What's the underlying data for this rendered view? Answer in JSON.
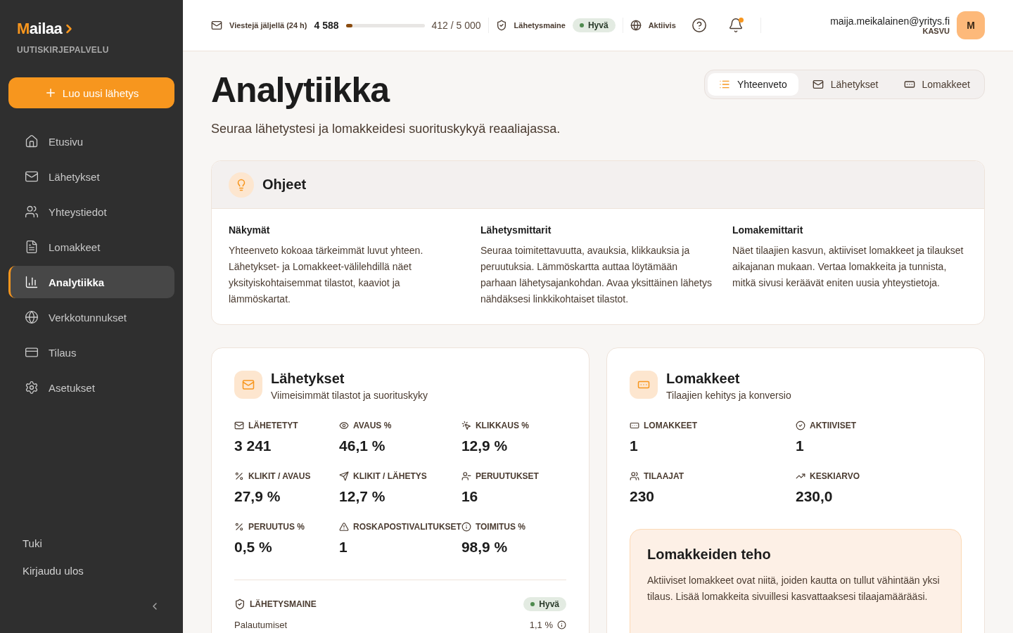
{
  "sidebar": {
    "logo": {
      "accent": "M",
      "rest": "ailaa"
    },
    "tagline": "UUTISKIRJEPALVELU",
    "new_button": "Luo uusi lähetys",
    "nav": [
      {
        "label": "Etusivu",
        "selected": false
      },
      {
        "label": "Lähetykset",
        "selected": false
      },
      {
        "label": "Yhteystiedot",
        "selected": false
      },
      {
        "label": "Lomakkeet",
        "selected": false
      },
      {
        "label": "Analytiikka",
        "selected": true
      },
      {
        "label": "Verkkotunnukset",
        "selected": false
      },
      {
        "label": "Tilaus",
        "selected": false
      },
      {
        "label": "Asetukset",
        "selected": false
      }
    ],
    "footer_links": [
      "Tuki",
      "Kirjaudu ulos"
    ]
  },
  "topbar": {
    "quota": {
      "label": "Viestejä jäljellä (24 h)",
      "remaining": "4 588",
      "level": 0.082,
      "usage": "412 / 5 000"
    },
    "reputation": {
      "label": "Lähetysmaine",
      "badge": "Hyvä",
      "color": "#4e8a4e"
    },
    "status": "Aktiivis",
    "notification_dot": true,
    "user": {
      "email": "maija.meikalainen@yritys.fi",
      "plan": "KASVU",
      "initial": "M"
    }
  },
  "page": {
    "title": "Analytiikka",
    "subtitle": "Seuraa lähetystesi ja lomakkeidesi suorituskykyä reaaliajassa.",
    "tabs": [
      {
        "label": "Yhteenveto",
        "selected": true
      },
      {
        "label": "Lähetykset",
        "selected": false
      },
      {
        "label": "Lomakkeet",
        "selected": false
      }
    ]
  },
  "guide": {
    "title": "Ohjeet",
    "columns": [
      {
        "title": "Näkymät",
        "text": "Yhteenveto kokoaa tärkeimmät luvut yhteen. Lähetykset- ja Lomakkeet-välilehdillä näet yksityiskohtaisemmat tilastot, kaaviot ja lämmöskartat."
      },
      {
        "title": "Lähetysmittarit",
        "text": "Seuraa toimitettavuutta, avauksia, klikkauksia ja peruutuksia. Lämmöskartta auttaa löytämään parhaan lähetysajankohdan. Avaa yksittäinen lähetys nähdäksesi linkkikohtaiset tilastot."
      },
      {
        "title": "Lomakemittarit",
        "text": "Näet tilaajien kasvun, aktiiviset lomakkeet ja tilaukset aikajanan mukaan. Vertaa lomakkeita ja tunnista, mitkä sivusi keräävät eniten uusia yhteystietoja."
      }
    ]
  },
  "sends": {
    "title": "Lähetykset",
    "subtitle": "Viimeisimmät tilastot ja suorituskyky",
    "metrics": [
      {
        "label": "LÄHETETYT",
        "value": "3 241"
      },
      {
        "label": "AVAUS %",
        "value": "46,1 %"
      },
      {
        "label": "KLIKKAUS %",
        "value": "12,9 %"
      },
      {
        "label": "KLIKIT / AVAUS",
        "value": "27,9 %"
      },
      {
        "label": "KLIKIT / LÄHETYS",
        "value": "12,7 %"
      },
      {
        "label": "PERUUTUKSET",
        "value": "16"
      },
      {
        "label": "PERUUTUS %",
        "value": "0,5 %"
      },
      {
        "label": "ROSKAPOSTIVALITUKSET",
        "value": "1"
      },
      {
        "label": "TOIMITUS %",
        "value": "98,9 %"
      }
    ],
    "reputation": {
      "label": "LÄHETYSMAINE",
      "badge": "Hyvä",
      "color": "#4e8a4e"
    },
    "rows": [
      {
        "label": "Palautumiset",
        "value": "1,1 %"
      }
    ]
  },
  "forms": {
    "title": "Lomakkeet",
    "subtitle": "Tilaajien kehitys ja konversio",
    "metrics": [
      {
        "label": "LOMAKKEET",
        "value": "1"
      },
      {
        "label": "AKTIIVISET",
        "value": "1"
      },
      {
        "label": "TILAAJAT",
        "value": "230"
      },
      {
        "label": "KESKIARVO",
        "value": "230,0"
      }
    ],
    "tip": {
      "title": "Lomakkeiden teho",
      "text": "Aktiiviset lomakkeet ovat niitä, joiden kautta on tullut vähintään yksi tilaus. Lisää lomakkeita sivuillesi kasvattaaksesi tilaajamäärääsi."
    }
  }
}
